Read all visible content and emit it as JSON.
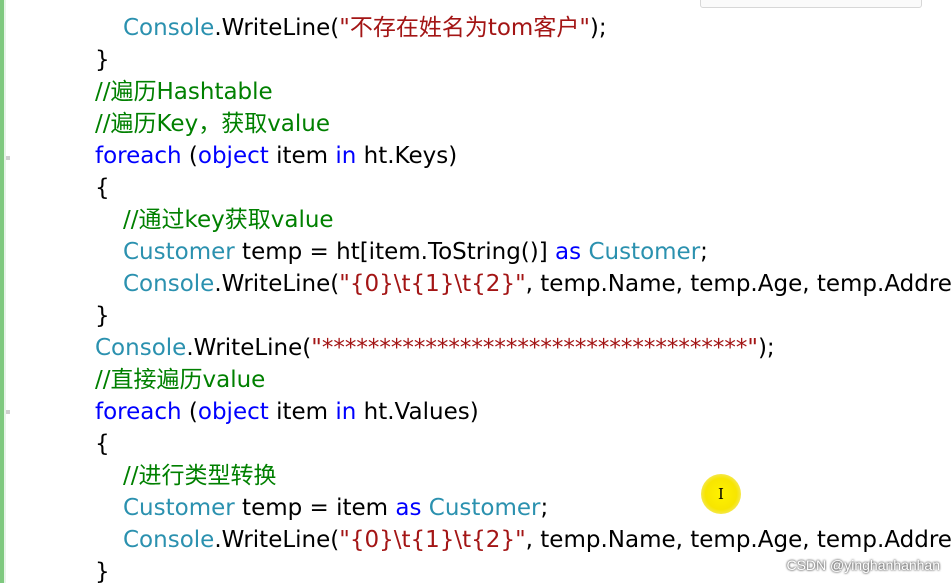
{
  "code": {
    "line1": {
      "parts": [
        "Console",
        ".WriteLine(",
        "\"不存在姓名为tom客户\"",
        ");"
      ]
    },
    "line2": {
      "text": "}"
    },
    "line3": {
      "text": "//遍历Hashtable"
    },
    "line4": {
      "text": "//遍历Key，获取value"
    },
    "line5": {
      "parts": [
        "foreach",
        " (",
        "object",
        " item ",
        "in",
        " ht.Keys)"
      ]
    },
    "line6": {
      "text": "{"
    },
    "line7": {
      "text": "//通过key获取value"
    },
    "line8": {
      "parts": [
        "Customer",
        " temp = ht[item.ToString()] ",
        "as",
        " ",
        "Customer",
        ";"
      ]
    },
    "line9": {
      "parts": [
        "Console",
        ".WriteLine(",
        "\"{0}\\t{1}\\t{2}\"",
        ", temp.Name, temp.Age, temp.Address);"
      ]
    },
    "line10": {
      "text": "}"
    },
    "line11": {
      "parts": [
        "Console",
        ".WriteLine(",
        "\"*************************************\"",
        ");"
      ]
    },
    "line12": {
      "text": "//直接遍历value"
    },
    "line13": {
      "parts": [
        "foreach",
        " (",
        "object",
        " item ",
        "in",
        " ht.Values)"
      ]
    },
    "line14": {
      "text": "{"
    },
    "line15": {
      "text": "//进行类型转换"
    },
    "line16": {
      "parts": [
        "Customer",
        " temp = item ",
        "as",
        " ",
        "Customer",
        ";"
      ]
    },
    "line17": {
      "parts": [
        "Console",
        ".WriteLine(",
        "\"{0}\\t{1}\\t{2}\"",
        ", temp.Name, temp.Age, temp.Address);"
      ]
    },
    "line18": {
      "text": "}"
    }
  },
  "cursor": {
    "glyph": "I",
    "icon": "text-cursor-icon"
  },
  "watermark": "CSDN @yinghanhanhan",
  "colors": {
    "keyword": "#0000ff",
    "type": "#2b91af",
    "comment": "#008000",
    "string": "#a31515",
    "highlight": "#fff200"
  }
}
